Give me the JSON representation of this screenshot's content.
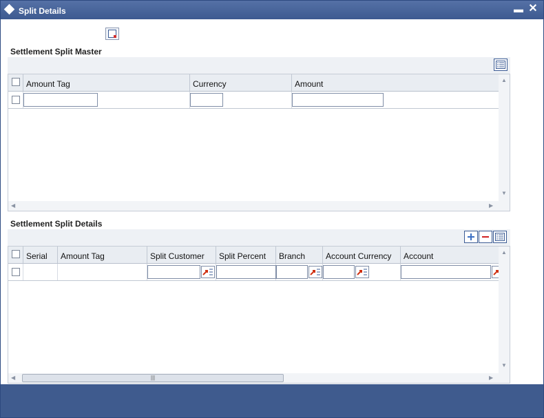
{
  "window": {
    "title": "Split Details",
    "minimize_glyph": "▬",
    "close_glyph": "✕"
  },
  "master": {
    "section_title": "Settlement Split Master",
    "columns": {
      "amount_tag": "Amount Tag",
      "currency": "Currency",
      "amount": "Amount"
    },
    "row": {
      "amount_tag": "",
      "currency": "",
      "amount": ""
    }
  },
  "details": {
    "section_title": "Settlement Split Details",
    "columns": {
      "serial": "Serial",
      "amount_tag": "Amount Tag",
      "split_customer": "Split Customer",
      "split_percent": "Split Percent",
      "branch": "Branch",
      "account_currency": "Account Currency",
      "account": "Account"
    },
    "row": {
      "serial": "",
      "amount_tag": "",
      "split_customer": "",
      "split_percent": "",
      "branch": "",
      "account_currency": "",
      "account": ""
    },
    "scroll_thumb_glyph": "|||"
  },
  "colors": {
    "title_bar": "#3d5a90",
    "accent": "#3b5b94",
    "add": "#3b6fc4",
    "delete": "#d02020",
    "lov": "#d03010"
  },
  "icons": [
    "diamond-icon",
    "minimize-icon",
    "close-icon",
    "document-icon",
    "list-icon",
    "add-icon",
    "delete-icon",
    "lov-icon"
  ]
}
